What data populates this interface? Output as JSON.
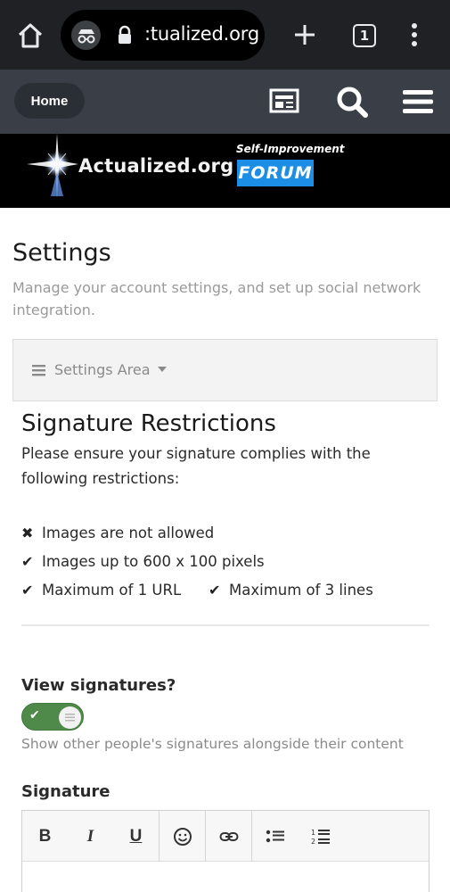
{
  "browser": {
    "url": ":tualized.org",
    "tab_count": "1"
  },
  "nav": {
    "home_label": "Home"
  },
  "banner": {
    "logo_text": "Actualized.org",
    "tagline_top": "Self-Improvement",
    "tagline_bottom": "FORUM"
  },
  "page": {
    "title": "Settings",
    "description": "Manage your account settings, and set up social network integration."
  },
  "settings_area": {
    "label": "Settings Area"
  },
  "signature_restrictions": {
    "title": "Signature Restrictions",
    "description": "Please ensure your signature complies with the following restrictions:",
    "items": [
      {
        "icon": "x-icon",
        "text": "Images are not allowed"
      },
      {
        "icon": "check-icon",
        "text": "Images up to 600 x 100 pixels"
      },
      {
        "icon": "check-icon",
        "text": "Maximum of 1 URL"
      },
      {
        "icon": "check-icon",
        "text": "Maximum of 3 lines"
      }
    ]
  },
  "view_signatures": {
    "label": "View signatures?",
    "enabled": true,
    "hint": "Show other people's signatures alongside their content"
  },
  "signature": {
    "label": "Signature",
    "toolbar": [
      "bold",
      "italic",
      "underline",
      "emoji",
      "link",
      "bulleted-list",
      "numbered-list"
    ],
    "bold_label": "B",
    "italic_label": "I",
    "underline_label": "U"
  },
  "colors": {
    "browser_bar": "#202124",
    "site_nav": "#3a3f47",
    "toggle_on": "#4f8a4a",
    "forum_badge": "#1d8ee6"
  }
}
